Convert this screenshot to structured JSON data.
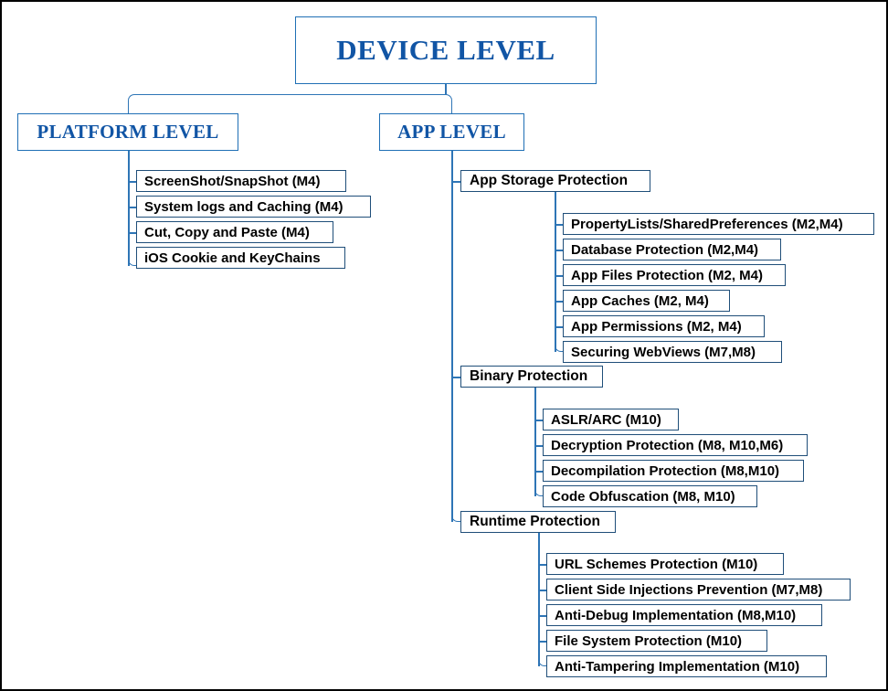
{
  "diagram": {
    "root": {
      "label": "DEVICE LEVEL"
    },
    "levels": [
      {
        "label": "PLATFORM LEVEL"
      },
      {
        "label": "APP LEVEL"
      }
    ],
    "platform_items": [
      {
        "label": "ScreenShot/SnapShot (M4)"
      },
      {
        "label": "System logs and Caching (M4)"
      },
      {
        "label": "Cut, Copy and Paste (M4)"
      },
      {
        "label": "iOS Cookie and KeyChains"
      }
    ],
    "app_categories": [
      {
        "label": "App Storage Protection",
        "items": [
          {
            "label": "PropertyLists/SharedPreferences (M2,M4)"
          },
          {
            "label": "Database Protection (M2,M4)"
          },
          {
            "label": "App Files Protection (M2, M4)"
          },
          {
            "label": "App Caches (M2, M4)"
          },
          {
            "label": "App Permissions (M2, M4)"
          },
          {
            "label": "Securing WebViews (M7,M8)"
          }
        ]
      },
      {
        "label": "Binary Protection",
        "items": [
          {
            "label": "ASLR/ARC (M10)"
          },
          {
            "label": "Decryption Protection (M8, M10,M6)"
          },
          {
            "label": "Decompilation Protection (M8,M10)"
          },
          {
            "label": "Code Obfuscation (M8, M10)"
          }
        ]
      },
      {
        "label": "Runtime Protection",
        "items": [
          {
            "label": "URL Schemes Protection (M10)"
          },
          {
            "label": "Client Side Injections Prevention (M7,M8)"
          },
          {
            "label": "Anti-Debug Implementation (M8,M10)"
          },
          {
            "label": "File System Protection (M10)"
          },
          {
            "label": "Anti-Tampering Implementation (M10)"
          }
        ]
      }
    ],
    "colors": {
      "header_text": "#1155A5",
      "header_border": "#1F6FB5",
      "box_border": "#1F4E79",
      "connector": "#2E75B6",
      "frame": "#000000"
    }
  }
}
